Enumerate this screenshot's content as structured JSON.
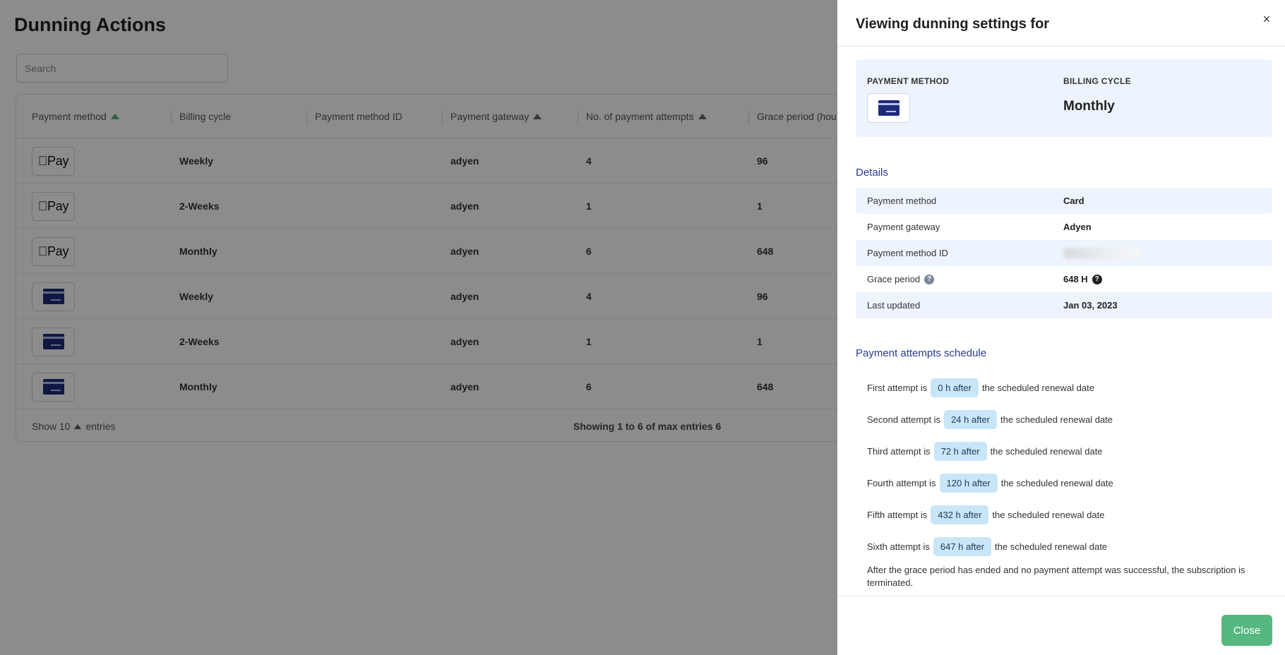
{
  "page": {
    "title": "Dunning Actions",
    "search_placeholder": "Search"
  },
  "table": {
    "columns": [
      {
        "label": "Payment method",
        "sorted": true
      },
      {
        "label": "Billing cycle",
        "sorted": false
      },
      {
        "label": "Payment method ID",
        "sorted": false
      },
      {
        "label": "Payment gateway",
        "sorted": true
      },
      {
        "label": "No. of payment attempts",
        "sorted": true
      },
      {
        "label": "Grace period (hou",
        "sorted": false
      }
    ],
    "rows": [
      {
        "method_icon": "apple-pay-icon",
        "billing_cycle": "Weekly",
        "gateway": "adyen",
        "attempts": "4",
        "grace": "96"
      },
      {
        "method_icon": "apple-pay-icon",
        "billing_cycle": "2-Weeks",
        "gateway": "adyen",
        "attempts": "1",
        "grace": "1"
      },
      {
        "method_icon": "apple-pay-icon",
        "billing_cycle": "Monthly",
        "gateway": "adyen",
        "attempts": "6",
        "grace": "648"
      },
      {
        "method_icon": "credit-card-icon",
        "billing_cycle": "Weekly",
        "gateway": "adyen",
        "attempts": "4",
        "grace": "96"
      },
      {
        "method_icon": "credit-card-icon",
        "billing_cycle": "2-Weeks",
        "gateway": "adyen",
        "attempts": "1",
        "grace": "1"
      },
      {
        "method_icon": "credit-card-icon",
        "billing_cycle": "Monthly",
        "gateway": "adyen",
        "attempts": "6",
        "grace": "648"
      }
    ],
    "apple_pay_label": "Pay",
    "footer": {
      "show_label": "Show 10",
      "entries_label": "entries",
      "showing": "Showing 1 to 6 of max entries 6"
    }
  },
  "drawer": {
    "title": "Viewing dunning settings for",
    "close_x": "×",
    "summary": {
      "payment_method_label": "PAYMENT METHOD",
      "billing_cycle_label": "BILLING CYCLE",
      "billing_cycle_value": "Monthly"
    },
    "details_title": "Details",
    "details": [
      {
        "label": "Payment method",
        "value": "Card"
      },
      {
        "label": "Payment gateway",
        "value": "Adyen"
      },
      {
        "label": "Payment method ID",
        "value": ""
      },
      {
        "label": "Grace period",
        "value": "648 H"
      },
      {
        "label": "Last updated",
        "value": "Jan 03, 2023"
      }
    ],
    "schedule_title": "Payment attempts schedule",
    "schedule_suffix": "the scheduled renewal date",
    "schedule": [
      {
        "prefix": "First attempt is",
        "pill": "0 h after"
      },
      {
        "prefix": "Second attempt is",
        "pill": "24 h after"
      },
      {
        "prefix": "Third attempt is",
        "pill": "72 h after"
      },
      {
        "prefix": "Fourth attempt is",
        "pill": "120 h after"
      },
      {
        "prefix": "Fifth attempt is",
        "pill": "432 h after"
      },
      {
        "prefix": "Sixth attempt is",
        "pill": "647 h after"
      }
    ],
    "note": "After the grace period has ended and no payment attempt was successful, the subscription is terminated.",
    "close_button": "Close"
  },
  "colors": {
    "accent_green": "#56b880",
    "sort_arrow": "#4caf7d",
    "card_navy": "#1e2a78",
    "pill_bg": "#c8e6f7",
    "summary_bg": "#eef4fd",
    "section_title": "#2b3a8f"
  }
}
